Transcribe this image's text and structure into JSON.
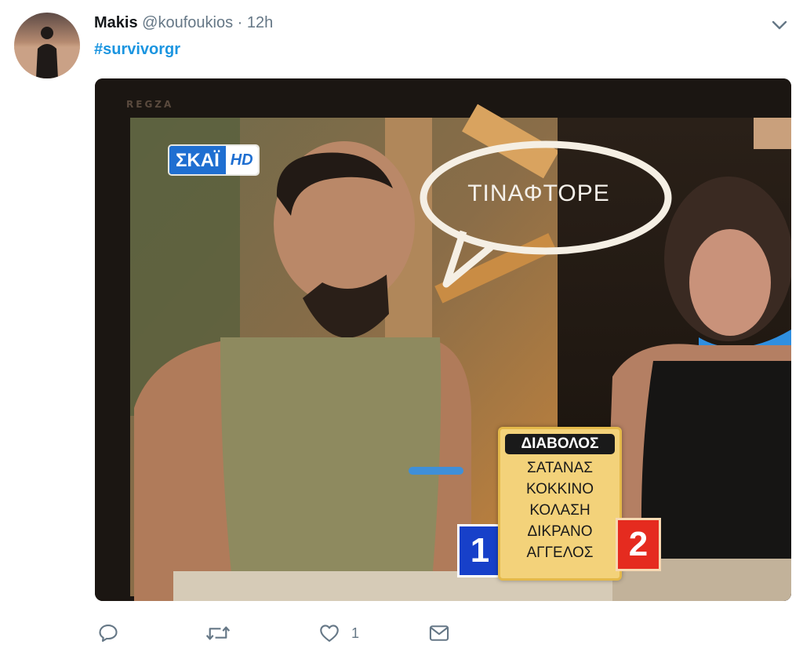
{
  "tweet": {
    "author_name": "Makis",
    "handle": "@koufoukios",
    "separator": "·",
    "time": "12h",
    "hashtag": "#survivorgr"
  },
  "media": {
    "tv_brand": "REGZA",
    "channel_logo": "ΣΚΑΪ",
    "channel_hd": "HD",
    "speech_bubble": "ΤΙΝΑΦΤΟΡΕ",
    "word_card": {
      "title": "ΔΙΑΒΟΛΟΣ",
      "words": [
        "ΣΑΤΑΝΑΣ",
        "ΚΟΚΚΙΝΟ",
        "ΚΟΛΑΣΗ",
        "ΔΙΚΡΑΝΟ",
        "ΑΓΓΕΛΟΣ"
      ]
    },
    "team_left_number": "1",
    "team_right_number": "2"
  },
  "actions": {
    "reply_icon": "reply-icon",
    "retweet_icon": "retweet-icon",
    "like_icon": "heart-icon",
    "like_count": "1",
    "dm_icon": "envelope-icon"
  },
  "colors": {
    "hashtag": "#1b95e0",
    "secondary_text": "#657786",
    "badge_blue": "#1740c9",
    "badge_red": "#e52b1f",
    "card_yellow": "#f3d27a"
  }
}
